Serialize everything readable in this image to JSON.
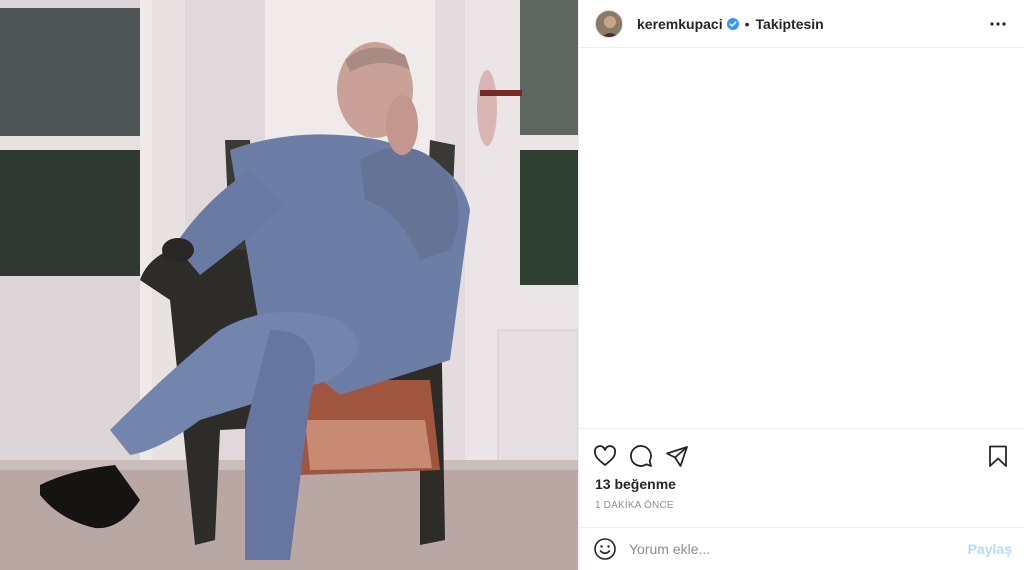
{
  "post": {
    "photo": {
      "description_icon": "photo"
    },
    "header": {
      "username": "keremkupaci",
      "verified_icon": "verified-badge-icon",
      "separator": "•",
      "follow_status": "Takiptesin",
      "more_icon": "more-options-icon"
    },
    "actions": {
      "like_icon": "heart-icon",
      "comment_icon": "comment-icon",
      "share_icon": "share-icon",
      "save_icon": "bookmark-icon"
    },
    "likes_text": "13 beğenme",
    "timestamp": "1 DAKİKA ÖNCE",
    "comment_box": {
      "placeholder": "Yorum ekle...",
      "post_label": "Paylaş",
      "emoji_icon": "emoji-icon"
    }
  },
  "colors": {
    "verified": "#3897f0",
    "post_disabled": "#b3dbff",
    "border": "#efefef",
    "text": "#262626",
    "muted": "#8e8e8e"
  }
}
